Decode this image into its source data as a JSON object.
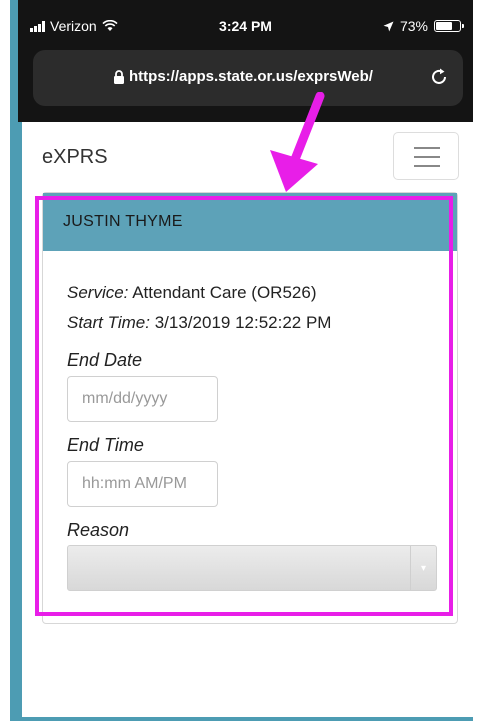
{
  "status_bar": {
    "carrier": "Verizon",
    "time": "3:24 PM",
    "battery_percent": "73%",
    "battery_level": 0.73
  },
  "browser": {
    "url": "https://apps.state.or.us/exprsWeb/"
  },
  "navbar": {
    "brand": "eXPRS"
  },
  "card": {
    "header_name": "JUSTIN THYME",
    "service_label": "Service:",
    "service_value": "Attendant Care (OR526)",
    "start_time_label": "Start Time:",
    "start_time_value": "3/13/2019 12:52:22 PM",
    "end_date_label": "End Date",
    "end_date_placeholder": "mm/dd/yyyy",
    "end_time_label": "End Time",
    "end_time_placeholder": "hh:mm AM/PM",
    "reason_label": "Reason",
    "reason_value": ""
  },
  "colors": {
    "card_header": "#5da2b8",
    "frame": "#4d9cb3",
    "annotation": "#e81ee8"
  }
}
